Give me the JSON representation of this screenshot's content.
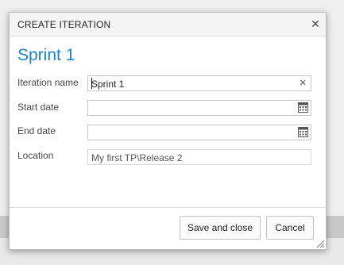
{
  "dialog": {
    "title": "CREATE ITERATION",
    "close_icon": "close-icon",
    "heading": "Sprint 1"
  },
  "form": {
    "iteration_name": {
      "label": "Iteration name",
      "value": "Sprint 1",
      "clear_icon": "clear-icon"
    },
    "start_date": {
      "label": "Start date",
      "value": "",
      "icon": "calendar-icon"
    },
    "end_date": {
      "label": "End date",
      "value": "",
      "icon": "calendar-icon"
    },
    "location": {
      "label": "Location",
      "value": "My first TP\\Release 2"
    }
  },
  "buttons": {
    "save_close": "Save and close",
    "cancel": "Cancel"
  },
  "colors": {
    "heading": "#1a86c8",
    "dialog_header_bg": "#f4f4f4",
    "backdrop": "#efefef"
  }
}
